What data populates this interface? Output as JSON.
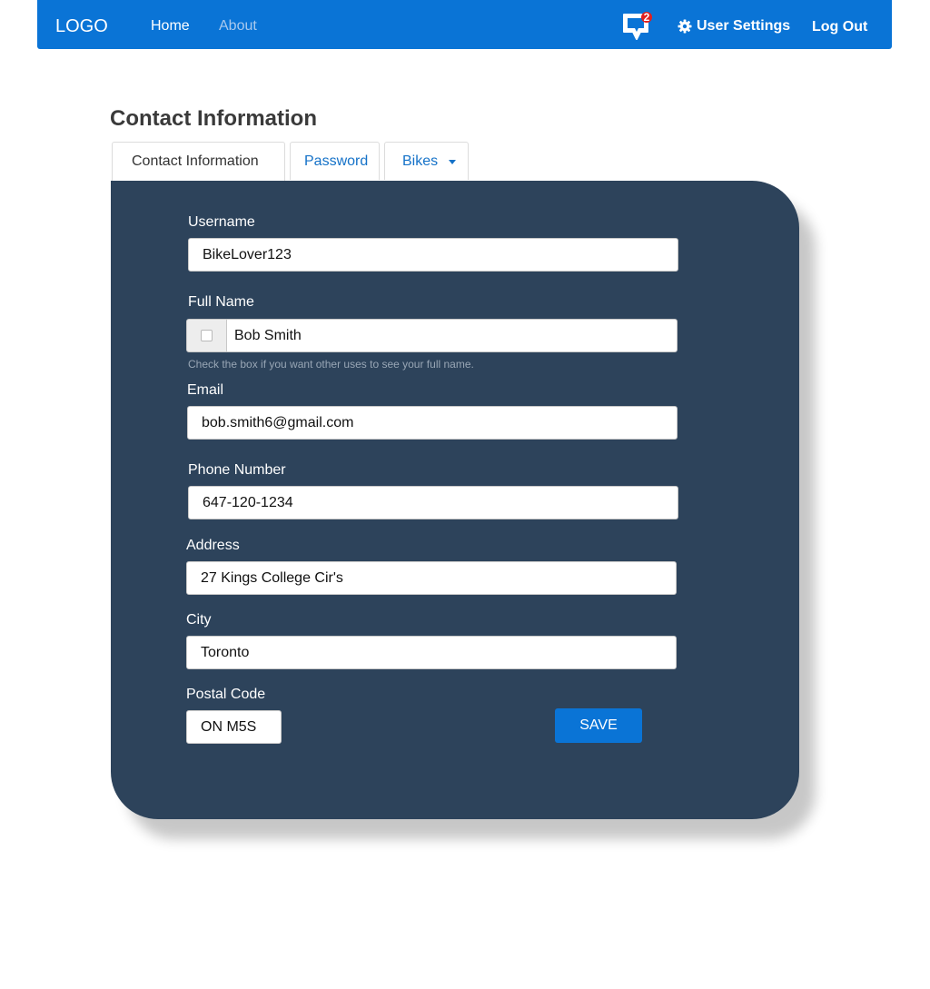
{
  "nav": {
    "logo": "LOGO",
    "home": "Home",
    "about": "About",
    "message_count": "2",
    "user_settings": "User Settings",
    "log_out": "Log Out"
  },
  "page_title": "Contact Information",
  "tabs": [
    {
      "label": "Contact Information",
      "active": true
    },
    {
      "label": "Password",
      "active": false
    },
    {
      "label": "Bikes",
      "active": false
    }
  ],
  "form": {
    "username": {
      "label": "Username",
      "value": "BikeLover123"
    },
    "full_name": {
      "label": "Full Name",
      "value": "Bob Smith",
      "help": "Check the box if you want other uses to see your full name."
    },
    "email": {
      "label": "Email",
      "value": "bob.smith6@gmail.com"
    },
    "phone": {
      "label": "Phone Number",
      "value": "647-120-1234"
    },
    "address": {
      "label": "Address",
      "value": "27 Kings College Cir's"
    },
    "city": {
      "label": "City",
      "value": "Toronto"
    },
    "postal": {
      "label": "Postal Code",
      "value": "ON M5S"
    },
    "save": "SAVE"
  },
  "colors": {
    "primary": "#0a74d6",
    "panel": "#2d435b",
    "badge": "#e0201f"
  },
  "icons": {
    "messages": "speech-bubble-icon",
    "settings": "gear-icon",
    "dropdown": "caret-down-icon"
  }
}
